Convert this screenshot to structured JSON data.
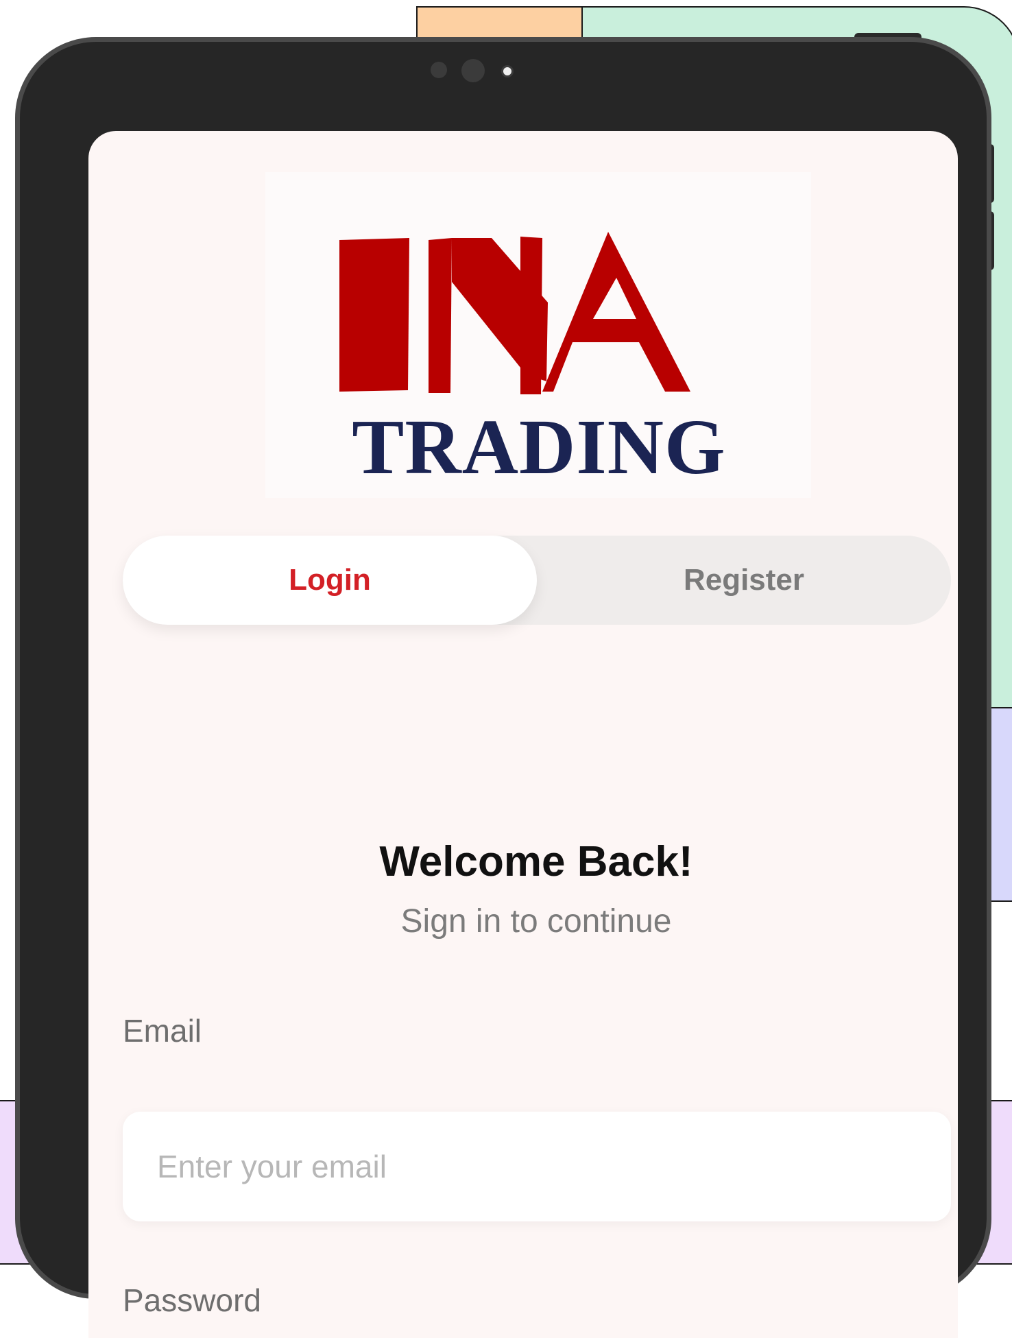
{
  "brand": {
    "logo_top": "INA",
    "logo_bottom": "TRADING",
    "red": "#b80000",
    "navy": "#1b2453"
  },
  "auth_tabs": {
    "login_label": "Login",
    "register_label": "Register",
    "active": "Login"
  },
  "welcome": {
    "title": "Welcome Back!",
    "subtitle": "Sign in to continue"
  },
  "form": {
    "email_label": "Email",
    "email_placeholder": "Enter your email",
    "email_value": "",
    "password_label": "Password"
  },
  "colors": {
    "accent": "#d32026",
    "screen_bg": "#fdf6f5"
  }
}
